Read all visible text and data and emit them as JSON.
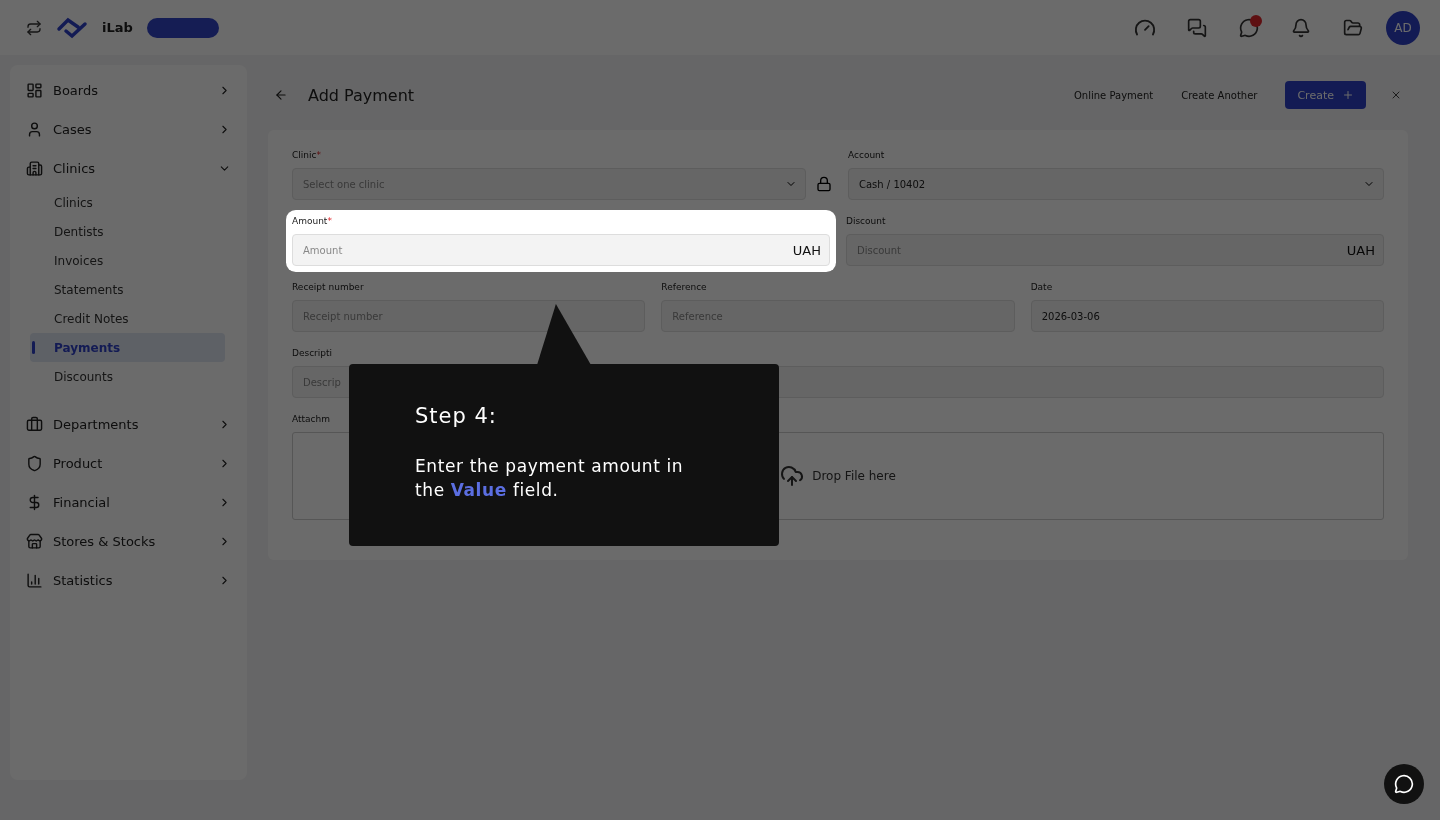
{
  "header": {
    "brand": "iLab",
    "avatar": "AD",
    "notifications_unread": true
  },
  "sidebar": {
    "items": [
      {
        "label": "Boards",
        "expanded": false
      },
      {
        "label": "Cases",
        "expanded": false
      },
      {
        "label": "Clinics",
        "expanded": true,
        "children": [
          {
            "label": "Clinics",
            "selected": false
          },
          {
            "label": "Dentists",
            "selected": false
          },
          {
            "label": "Invoices",
            "selected": false
          },
          {
            "label": "Statements",
            "selected": false
          },
          {
            "label": "Credit Notes",
            "selected": false
          },
          {
            "label": "Payments",
            "selected": true
          },
          {
            "label": "Discounts",
            "selected": false
          }
        ]
      },
      {
        "label": "Departments",
        "expanded": false
      },
      {
        "label": "Product",
        "expanded": false
      },
      {
        "label": "Financial",
        "expanded": false
      },
      {
        "label": "Stores & Stocks",
        "expanded": false
      },
      {
        "label": "Statistics",
        "expanded": false
      }
    ]
  },
  "page": {
    "title": "Add Payment",
    "actions": [
      "Online Payment",
      "Create Another"
    ],
    "create_button": "Create"
  },
  "form": {
    "rows": [
      [
        {
          "kind": "select",
          "label": "Clinic",
          "required_mark": "*",
          "placeholder": "Select one clinic",
          "lock": true,
          "highlighted": false
        },
        {
          "kind": "select",
          "label": "Account",
          "value": "Cash / 10402",
          "highlighted": false
        }
      ],
      [
        {
          "kind": "money",
          "label": "Amount",
          "required_mark": "*",
          "placeholder": "Amount",
          "suffix": "UAH",
          "highlighted": true
        },
        {
          "kind": "money",
          "label": "Discount",
          "placeholder": "Discount",
          "suffix": "UAH",
          "highlighted": false
        }
      ],
      [
        {
          "kind": "text",
          "label": "Receipt number",
          "placeholder": "Receipt number",
          "highlighted": false
        },
        {
          "kind": "text",
          "label": "Reference",
          "placeholder": "Reference",
          "highlighted": false
        },
        {
          "kind": "text",
          "label": "Date",
          "value": "2026-03-06",
          "highlighted": false
        }
      ],
      [
        {
          "kind": "text",
          "label": "Descripti",
          "placeholder": "Descrip",
          "highlighted": false
        }
      ]
    ],
    "attachments": {
      "label": "Attachm",
      "drop_text": "Drop File here"
    }
  },
  "tour": {
    "title": "Step 4:",
    "body": "Enter the payment amount in the **Value** field."
  }
}
